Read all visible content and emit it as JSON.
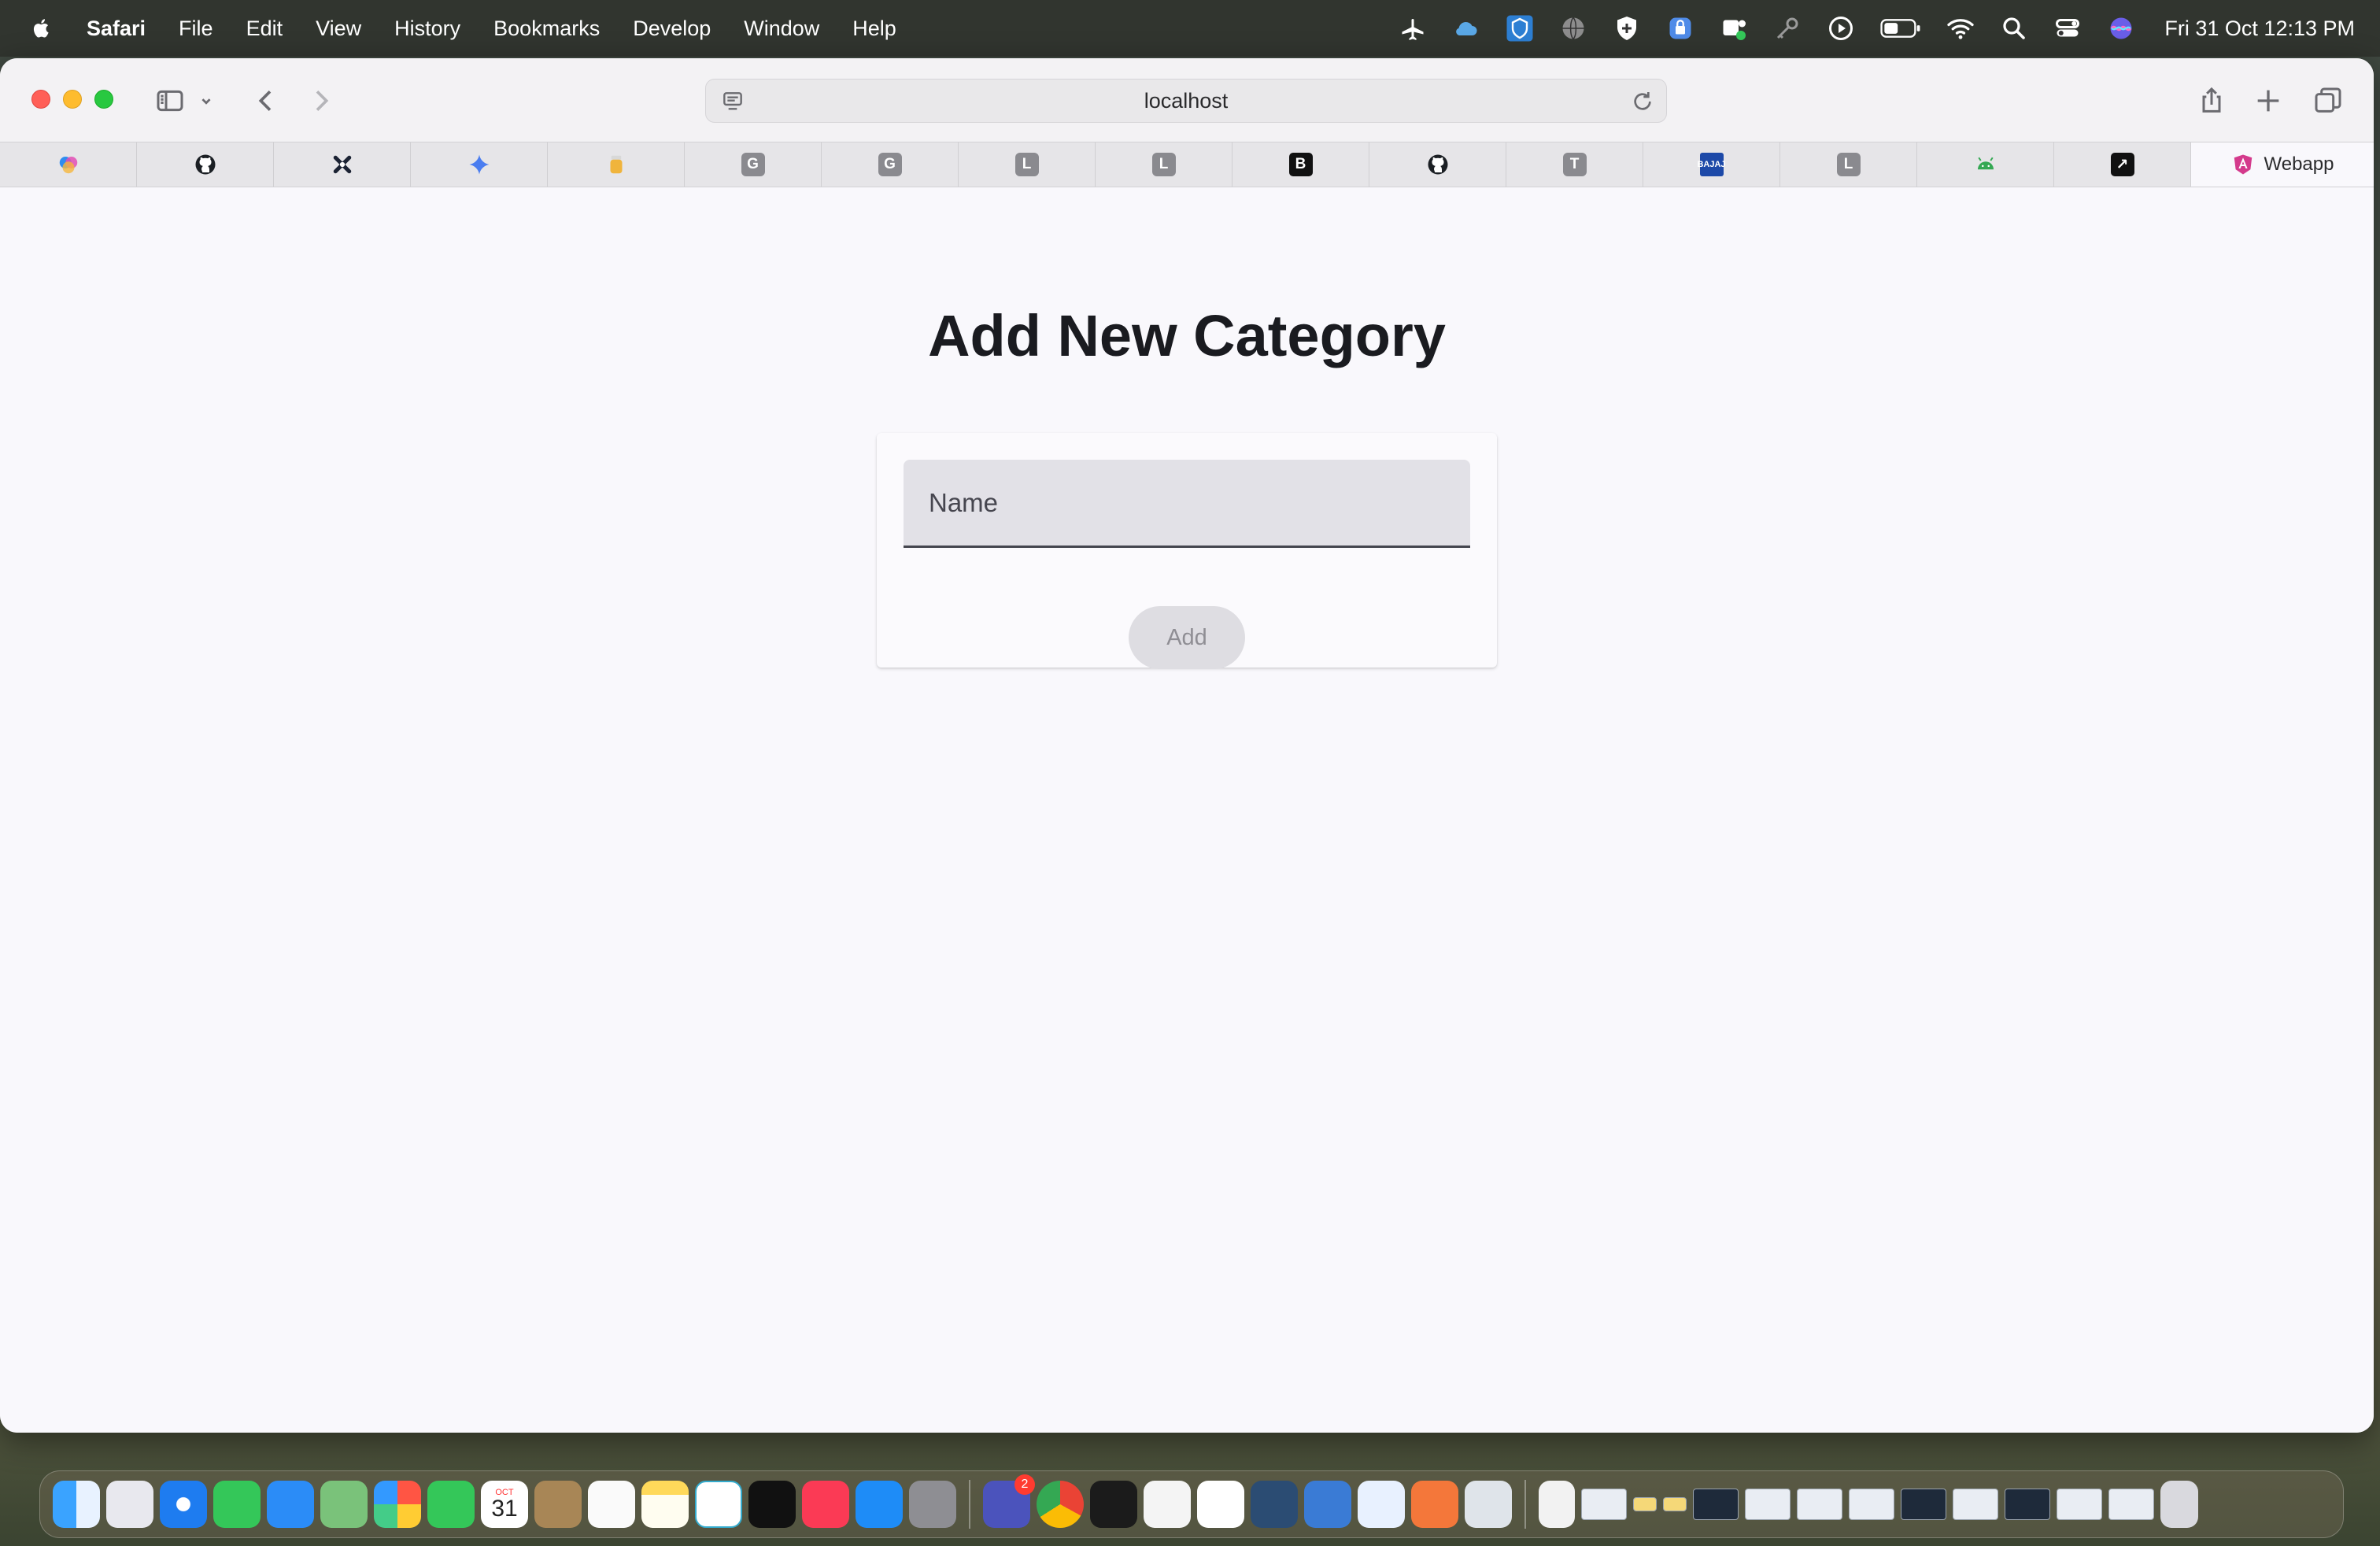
{
  "menubar": {
    "app_name": "Safari",
    "items": [
      "File",
      "Edit",
      "View",
      "History",
      "Bookmarks",
      "Develop",
      "Window",
      "Help"
    ],
    "clock": "Fri 31 Oct  12:13 PM"
  },
  "browser": {
    "url": "localhost",
    "active_tab_label": "Webapp",
    "pinned_tabs": [
      {
        "kind": "copilot-icon"
      },
      {
        "kind": "github-icon"
      },
      {
        "kind": "x-logo-icon"
      },
      {
        "kind": "gemini-icon"
      },
      {
        "kind": "jar-icon"
      },
      {
        "kind": "letter",
        "text": "G"
      },
      {
        "kind": "letter",
        "text": "G"
      },
      {
        "kind": "letter",
        "text": "L"
      },
      {
        "kind": "letter",
        "text": "L"
      },
      {
        "kind": "dark",
        "text": "B"
      },
      {
        "kind": "github-icon"
      },
      {
        "kind": "letter",
        "text": "T"
      },
      {
        "kind": "blue",
        "text": "BAJAJ"
      },
      {
        "kind": "letter",
        "text": "L"
      },
      {
        "kind": "android-icon"
      },
      {
        "kind": "dark",
        "text": "↗"
      }
    ]
  },
  "page": {
    "title": "Add New Category",
    "name_placeholder": "Name",
    "name_value": "",
    "add_label": "Add"
  },
  "dock": {
    "teams_badge": "2",
    "calendar_month": "OCT",
    "calendar_day": "31"
  }
}
